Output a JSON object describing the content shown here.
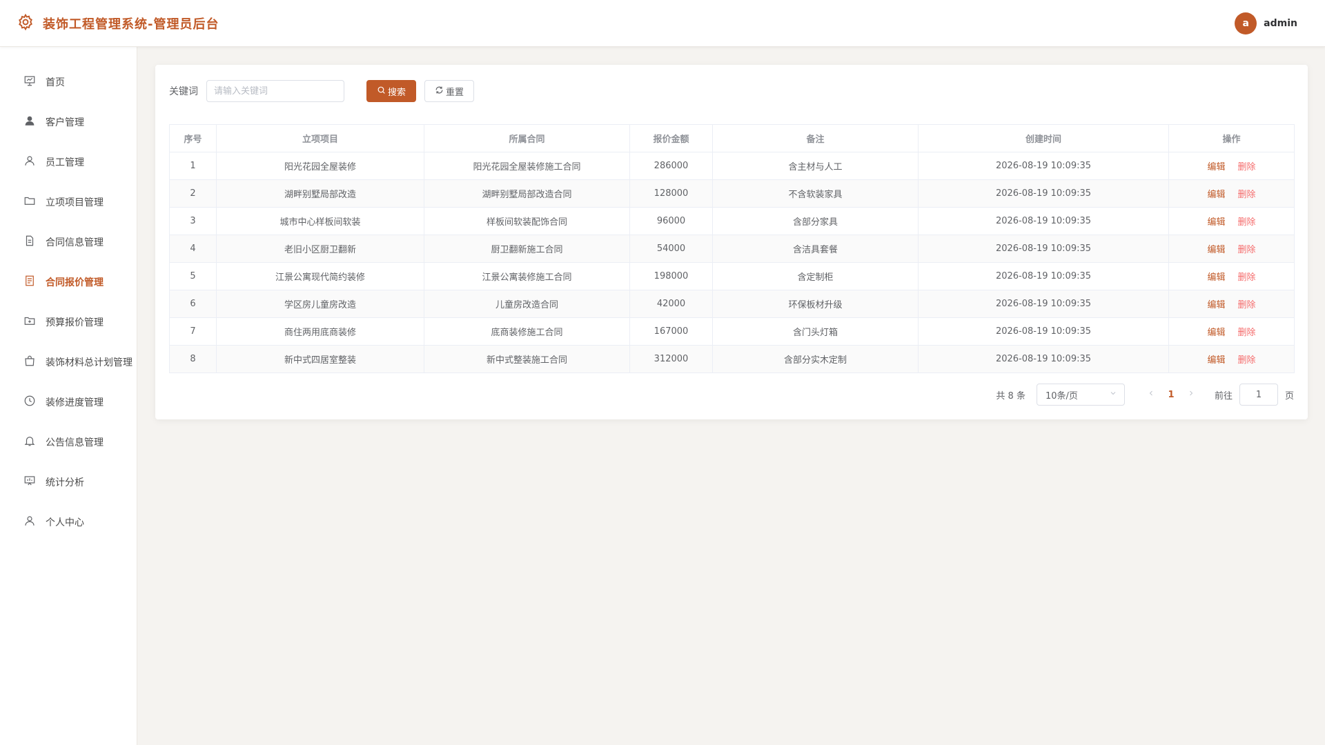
{
  "header": {
    "title": "装饰工程管理系统-管理员后台",
    "avatar_letter": "a",
    "username": "admin"
  },
  "sidebar": {
    "items": [
      {
        "label": "首页",
        "icon": "presentation-icon"
      },
      {
        "label": "客户管理",
        "icon": "user-filled-icon"
      },
      {
        "label": "员工管理",
        "icon": "user-icon"
      },
      {
        "label": "立项项目管理",
        "icon": "folder-icon"
      },
      {
        "label": "合同信息管理",
        "icon": "document-icon"
      },
      {
        "label": "合同报价管理",
        "icon": "tickets-icon",
        "active": true
      },
      {
        "label": "预算报价管理",
        "icon": "folder-add-icon"
      },
      {
        "label": "装饰材料总计划管理",
        "icon": "shopping-bag-icon"
      },
      {
        "label": "装修进度管理",
        "icon": "clock-icon"
      },
      {
        "label": "公告信息管理",
        "icon": "bell-icon"
      },
      {
        "label": "统计分析",
        "icon": "data-board-icon"
      },
      {
        "label": "个人中心",
        "icon": "user-icon"
      }
    ]
  },
  "search": {
    "label": "关键词",
    "placeholder": "请输入关键词",
    "value": "",
    "search_button": "搜索",
    "reset_button": "重置"
  },
  "table": {
    "columns": [
      "序号",
      "立项项目",
      "所属合同",
      "报价金额",
      "备注",
      "创建时间",
      "操作"
    ],
    "rows": [
      {
        "no": "1",
        "project": "阳光花园全屋装修",
        "contract": "阳光花园全屋装修施工合同",
        "amount": "286000",
        "remark": "含主材与人工",
        "created": "2026-08-19 10:09:35"
      },
      {
        "no": "2",
        "project": "湖畔别墅局部改造",
        "contract": "湖畔别墅局部改造合同",
        "amount": "128000",
        "remark": "不含软装家具",
        "created": "2026-08-19 10:09:35"
      },
      {
        "no": "3",
        "project": "城市中心样板间软装",
        "contract": "样板间软装配饰合同",
        "amount": "96000",
        "remark": "含部分家具",
        "created": "2026-08-19 10:09:35"
      },
      {
        "no": "4",
        "project": "老旧小区厨卫翻新",
        "contract": "厨卫翻新施工合同",
        "amount": "54000",
        "remark": "含洁具套餐",
        "created": "2026-08-19 10:09:35"
      },
      {
        "no": "5",
        "project": "江景公寓现代简约装修",
        "contract": "江景公寓装修施工合同",
        "amount": "198000",
        "remark": "含定制柜",
        "created": "2026-08-19 10:09:35"
      },
      {
        "no": "6",
        "project": "学区房儿童房改造",
        "contract": "儿童房改造合同",
        "amount": "42000",
        "remark": "环保板材升级",
        "created": "2026-08-19 10:09:35"
      },
      {
        "no": "7",
        "project": "商住两用底商装修",
        "contract": "底商装修施工合同",
        "amount": "167000",
        "remark": "含门头灯箱",
        "created": "2026-08-19 10:09:35"
      },
      {
        "no": "8",
        "project": "新中式四居室整装",
        "contract": "新中式整装施工合同",
        "amount": "312000",
        "remark": "含部分实木定制",
        "created": "2026-08-19 10:09:35"
      }
    ],
    "edit_label": "编辑",
    "delete_label": "删除"
  },
  "pagination": {
    "total_text": "共 8 条",
    "page_size": "10条/页",
    "current_page": "1",
    "goto_label": "前往",
    "goto_value": "1",
    "page_unit": "页"
  },
  "colors": {
    "accent": "#c15a28",
    "danger": "#f56c6c",
    "background": "#f5f3f0"
  }
}
